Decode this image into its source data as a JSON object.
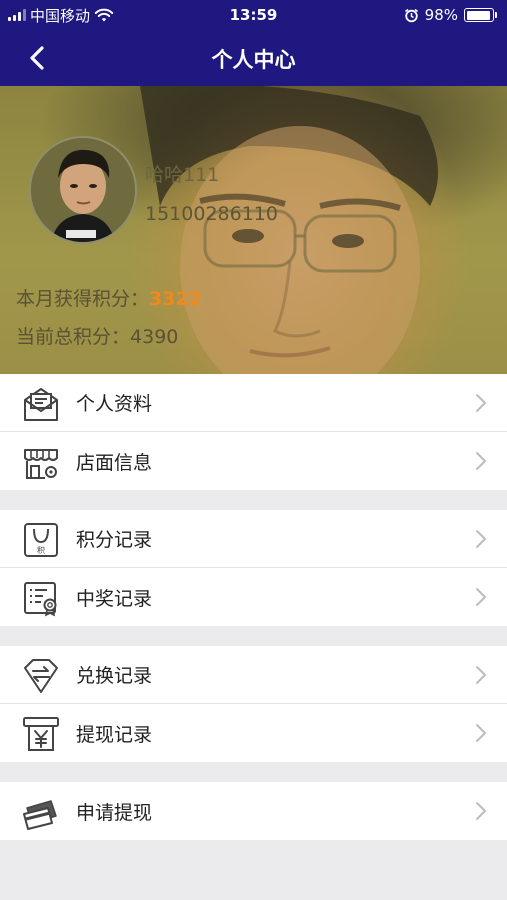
{
  "status_bar": {
    "carrier": "中国移动",
    "time": "13:59",
    "battery": "98%"
  },
  "nav": {
    "title": "个人中心"
  },
  "profile": {
    "username": "哈哈111",
    "phone": "15100286110",
    "month_points_label": "本月获得积分：",
    "month_points_value": "3322",
    "total_points_label": "当前总积分：",
    "total_points_value": "4390"
  },
  "menu_groups": [
    {
      "items": [
        {
          "label": "个人资料",
          "icon": "envelope-icon"
        },
        {
          "label": "店面信息",
          "icon": "storefront-icon"
        }
      ]
    },
    {
      "items": [
        {
          "label": "积分记录",
          "icon": "points-bag-icon"
        },
        {
          "label": "中奖记录",
          "icon": "certificate-icon"
        }
      ]
    },
    {
      "items": [
        {
          "label": "兑换记录",
          "icon": "exchange-gem-icon"
        },
        {
          "label": "提现记录",
          "icon": "yuan-receipt-icon"
        }
      ]
    },
    {
      "items": [
        {
          "label": "申请提现",
          "icon": "cards-icon"
        }
      ]
    }
  ],
  "colors": {
    "nav_bg": "#1e1880",
    "accent_points": "#f08a1e",
    "menu_text": "#222222",
    "page_bg": "#ebebed"
  }
}
